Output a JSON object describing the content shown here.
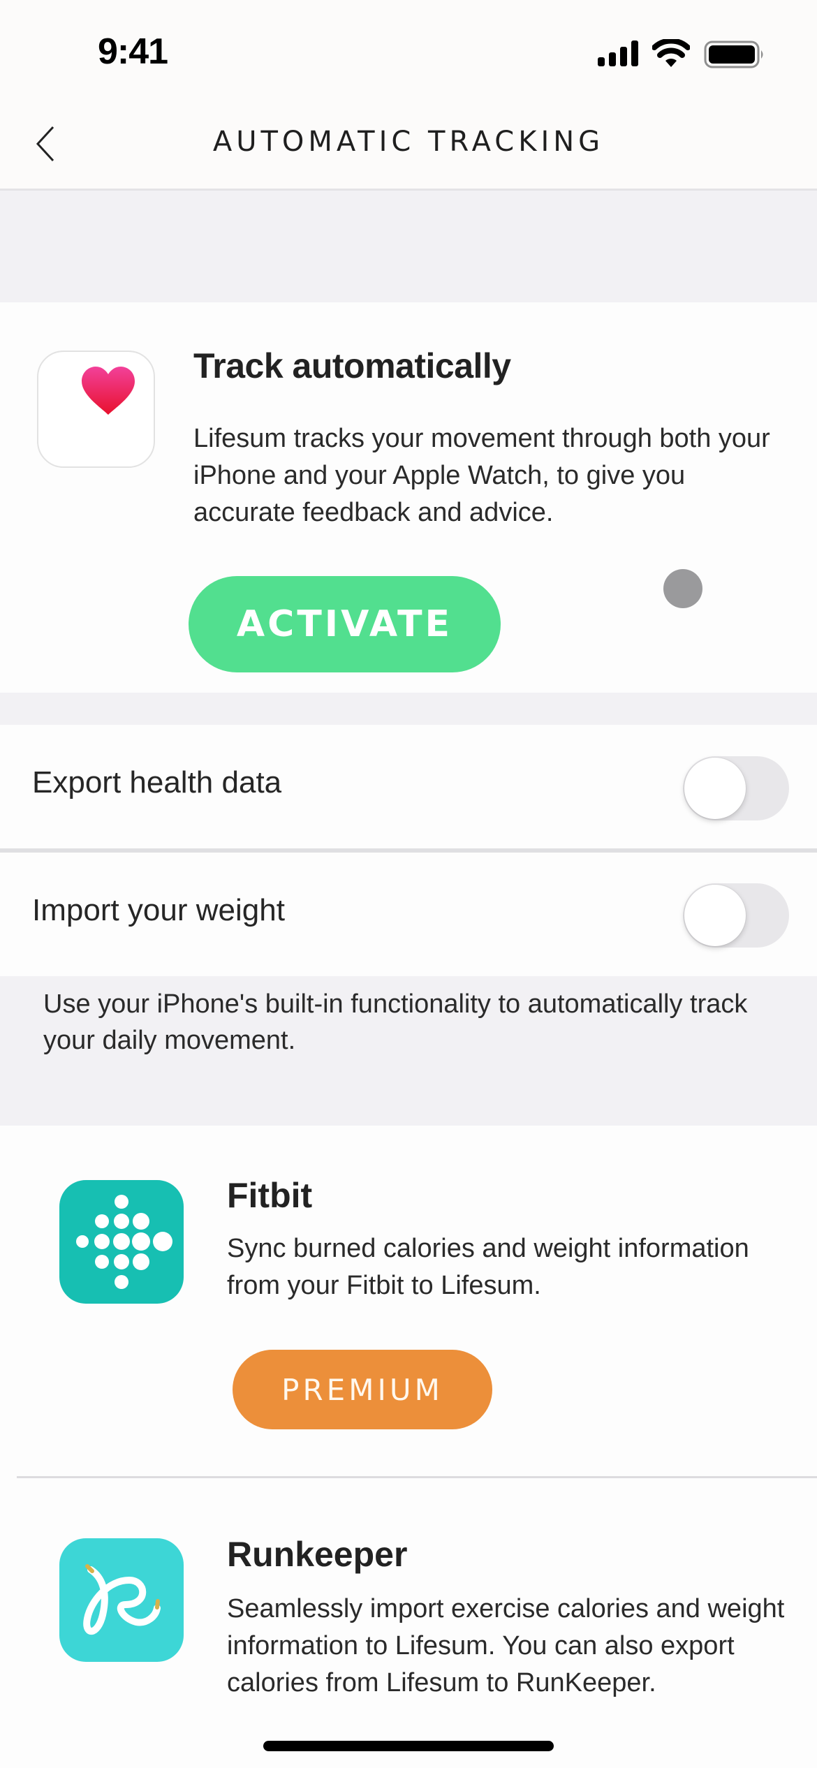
{
  "status_bar": {
    "time": "9:41",
    "icons": [
      "cellular-signal-icon",
      "wifi-icon",
      "battery-full-icon"
    ]
  },
  "nav": {
    "back_icon": "chevron-left-icon",
    "title": "AUTOMATIC TRACKING"
  },
  "track_card": {
    "icon": "apple-health-heart-icon",
    "title": "Track automatically",
    "body": "Lifesum tracks your movement through both your iPhone and your Apple Watch, to give you accurate feedback and advice.",
    "button_label": "ACTIVATE",
    "colors": {
      "button": "#52DF8F",
      "heart_top": "#F2419A",
      "heart_bottom": "#E8112D"
    }
  },
  "settings": [
    {
      "label": "Export health data",
      "enabled": false
    },
    {
      "label": "Import your weight",
      "enabled": false
    }
  ],
  "settings_footer": "Use your iPhone's built-in functionality to automatically track your daily movement.",
  "integrations": [
    {
      "name": "Fitbit",
      "icon": "fitbit-icon",
      "description": "Sync burned calories and weight information from your Fitbit to Lifesum.",
      "button_label": "PREMIUM",
      "colors": {
        "icon_bg": "#17BFB2",
        "button": "#EC8F3A"
      }
    },
    {
      "name": "Runkeeper",
      "icon": "runkeeper-icon",
      "description": "Seamlessly import exercise calories and weight information to Lifesum. You can also export calories from Lifesum to RunKeeper.",
      "colors": {
        "icon_bg": "#3DD6D6"
      }
    }
  ]
}
